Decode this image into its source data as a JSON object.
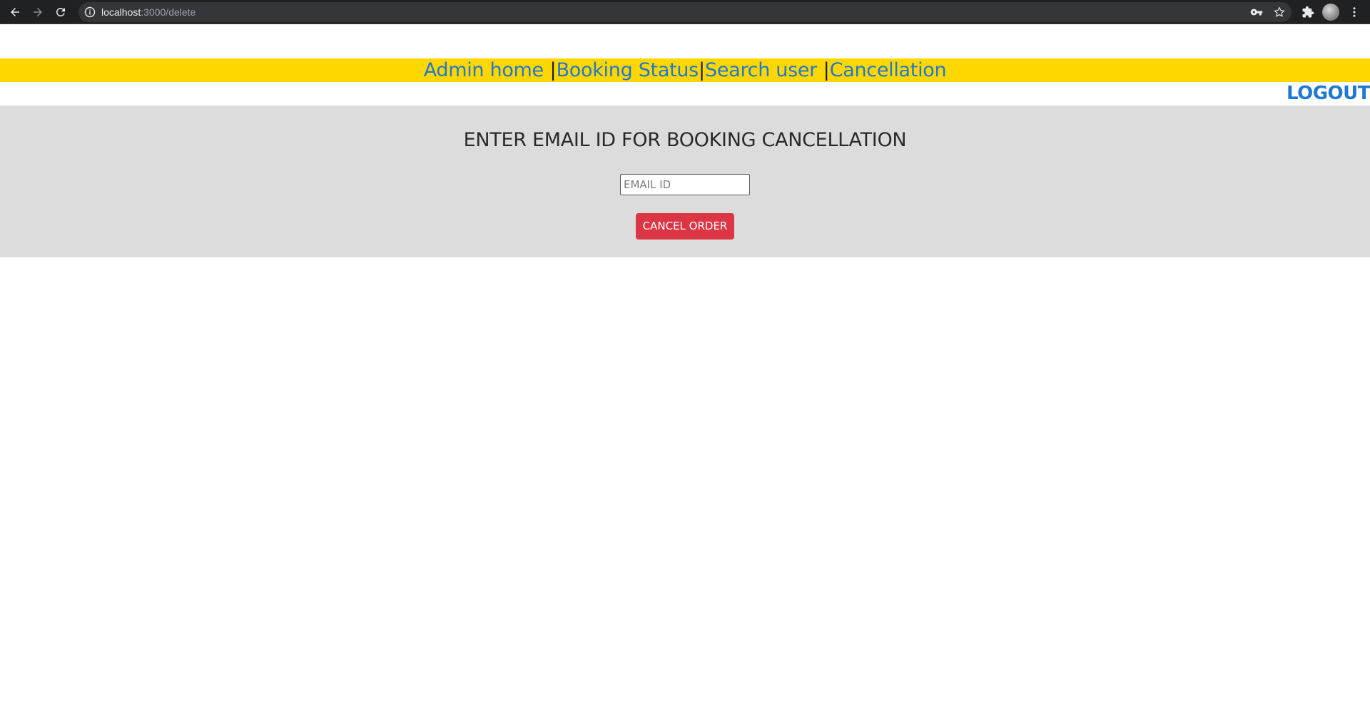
{
  "browser": {
    "url_host": "localhost",
    "url_path": ":3000/delete",
    "icons": [
      "back-arrow-icon",
      "forward-arrow-icon",
      "reload-icon",
      "info-icon",
      "key-icon",
      "star-icon",
      "extensions-icon",
      "profile-avatar",
      "menu-dots-icon"
    ]
  },
  "nav": {
    "links": [
      {
        "label": "Admin home",
        "sep_after": " |"
      },
      {
        "label": "Booking Status",
        "sep_after": "|"
      },
      {
        "label": "Search user",
        "sep_after": " |"
      },
      {
        "label": "Cancellation",
        "sep_after": ""
      }
    ],
    "bar_color": "#ffd700",
    "link_color": "#1f78d1"
  },
  "logout": {
    "label": "LOGOUT"
  },
  "cancel_form": {
    "title": "ENTER EMAIL ID FOR BOOKING CANCELLATION",
    "email_placeholder": "EMAIL ID",
    "email_value": "",
    "submit_label": "CANCEL ORDER",
    "submit_color": "#dc3545",
    "panel_color": "#dcdcdc"
  }
}
